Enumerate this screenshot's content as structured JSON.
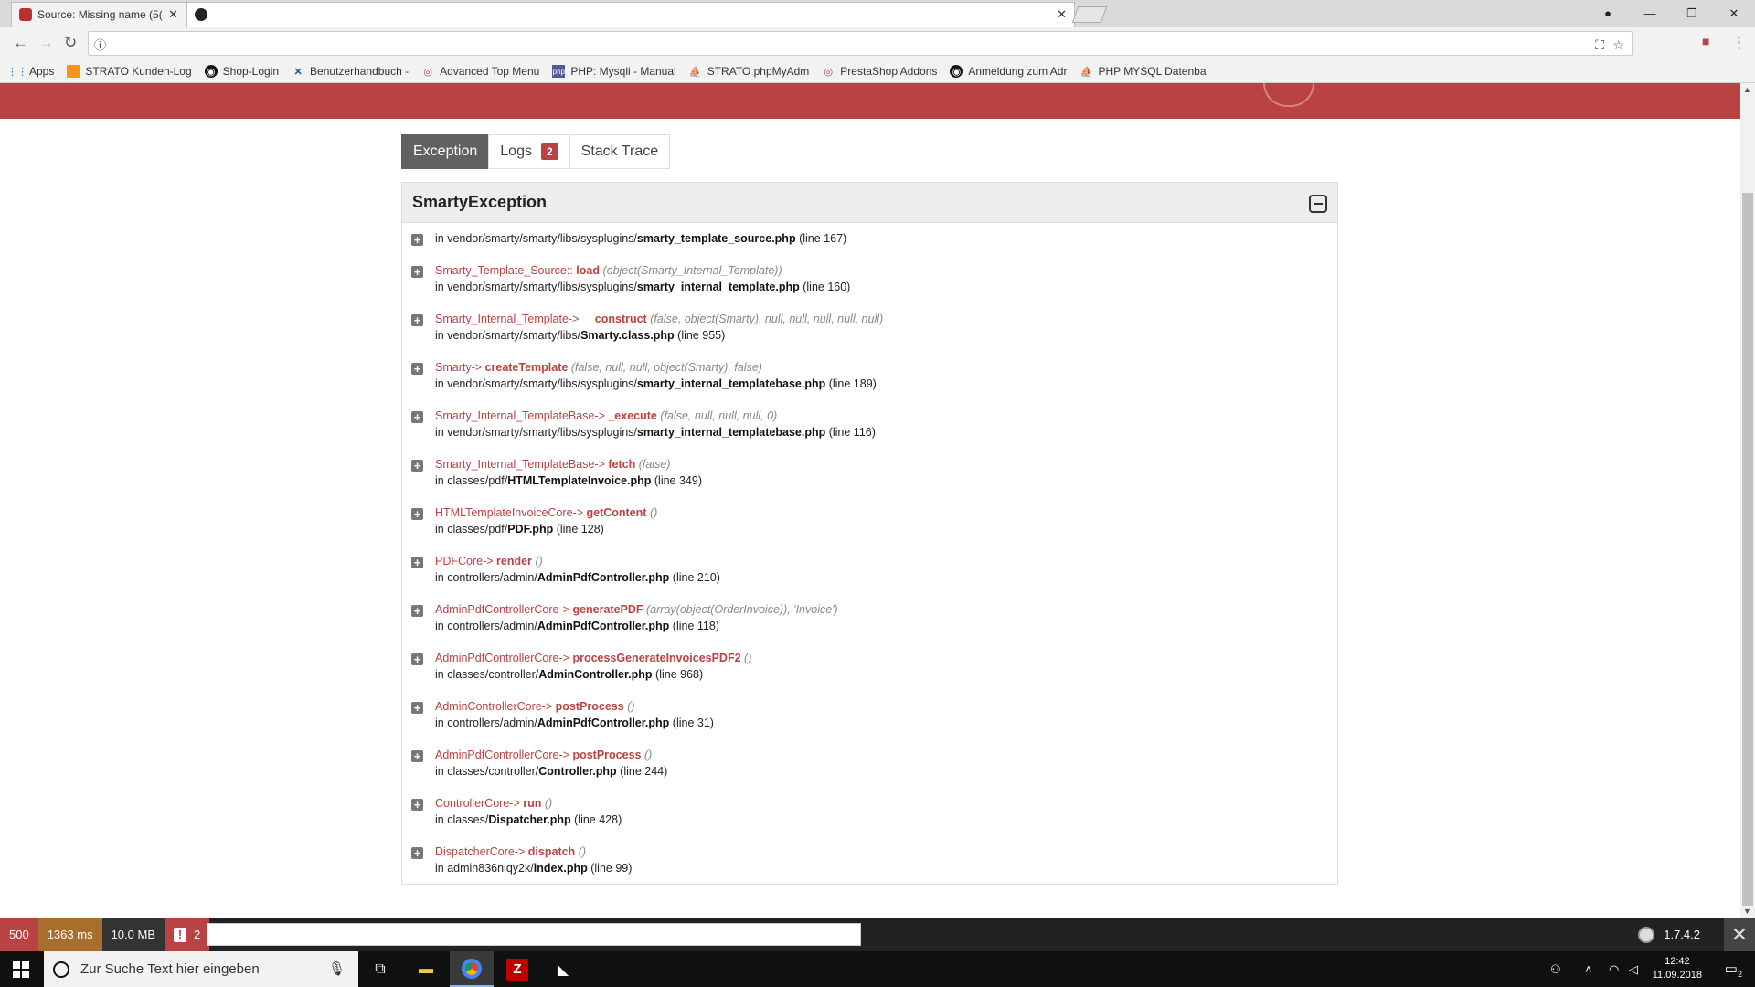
{
  "browser": {
    "active_tab_title": "Source: Missing name (5(",
    "address_icon": "info-icon",
    "bookmarks": [
      {
        "label": "Apps",
        "icon": "apps-grid-icon"
      },
      {
        "label": "STRATO Kunden-Log",
        "icon": "strato-icon"
      },
      {
        "label": "Shop-Login",
        "icon": "prestashop-icon"
      },
      {
        "label": "Benutzerhandbuch -",
        "icon": "confluence-icon"
      },
      {
        "label": "Advanced Top Menu",
        "icon": "addon-icon"
      },
      {
        "label": "PHP: Mysqli - Manual",
        "icon": "php-icon"
      },
      {
        "label": "STRATO phpMyAdm",
        "icon": "phpmyadmin-icon"
      },
      {
        "label": "PrestaShop Addons",
        "icon": "addon-icon"
      },
      {
        "label": "Anmeldung zum Adr",
        "icon": "prestashop-icon"
      },
      {
        "label": "PHP MYSQL Datenba",
        "icon": "phpmyadmin-icon"
      }
    ]
  },
  "tabs": [
    {
      "label": "Exception",
      "active": true
    },
    {
      "label": "Logs",
      "badge": "2"
    },
    {
      "label": "Stack Trace"
    }
  ],
  "exception": {
    "title": "SmartyException",
    "frames": [
      {
        "class": "",
        "type": "",
        "function": "",
        "args": "",
        "path": "in vendor/smarty/smarty/libs/sysplugins/",
        "file": "smarty_template_source.php",
        "line": "(line 167)"
      },
      {
        "class": "Smarty_Template_Source",
        "type": "::",
        "function": "load",
        "args": "(object(Smarty_Internal_Template))",
        "path": "in vendor/smarty/smarty/libs/sysplugins/",
        "file": "smarty_internal_template.php",
        "line": "(line 160)"
      },
      {
        "class": "Smarty_Internal_Template",
        "type": "->",
        "function": "__construct",
        "args": "(false, object(Smarty), null, null, null, null, null)",
        "path": "in vendor/smarty/smarty/libs/",
        "file": "Smarty.class.php",
        "line": "(line 955)"
      },
      {
        "class": "Smarty",
        "type": "->",
        "function": "createTemplate",
        "args": "(false, null, null, object(Smarty), false)",
        "path": "in vendor/smarty/smarty/libs/sysplugins/",
        "file": "smarty_internal_templatebase.php",
        "line": "(line 189)"
      },
      {
        "class": "Smarty_Internal_TemplateBase",
        "type": "->",
        "function": "_execute",
        "args": "(false, null, null, null, 0)",
        "path": "in vendor/smarty/smarty/libs/sysplugins/",
        "file": "smarty_internal_templatebase.php",
        "line": "(line 116)"
      },
      {
        "class": "Smarty_Internal_TemplateBase",
        "type": "->",
        "function": "fetch",
        "args": "(false)",
        "path": "in classes/pdf/",
        "file": "HTMLTemplateInvoice.php",
        "line": "(line 349)"
      },
      {
        "class": "HTMLTemplateInvoiceCore",
        "type": "->",
        "function": "getContent",
        "args": "()",
        "path": "in classes/pdf/",
        "file": "PDF.php",
        "line": "(line 128)"
      },
      {
        "class": "PDFCore",
        "type": "->",
        "function": "render",
        "args": "()",
        "path": "in controllers/admin/",
        "file": "AdminPdfController.php",
        "line": "(line 210)"
      },
      {
        "class": "AdminPdfControllerCore",
        "type": "->",
        "function": "generatePDF",
        "args": "(array(object(OrderInvoice)), 'Invoice')",
        "path": "in controllers/admin/",
        "file": "AdminPdfController.php",
        "line": "(line 118)"
      },
      {
        "class": "AdminPdfControllerCore",
        "type": "->",
        "function": "processGenerateInvoicesPDF2",
        "args": "()",
        "path": "in classes/controller/",
        "file": "AdminController.php",
        "line": "(line 968)"
      },
      {
        "class": "AdminControllerCore",
        "type": "->",
        "function": "postProcess",
        "args": "()",
        "path": "in controllers/admin/",
        "file": "AdminPdfController.php",
        "line": "(line 31)"
      },
      {
        "class": "AdminPdfControllerCore",
        "type": "->",
        "function": "postProcess",
        "args": "()",
        "path": "in classes/controller/",
        "file": "Controller.php",
        "line": "(line 244)"
      },
      {
        "class": "ControllerCore",
        "type": "->",
        "function": "run",
        "args": "()",
        "path": "in classes/",
        "file": "Dispatcher.php",
        "line": "(line 428)"
      },
      {
        "class": "DispatcherCore",
        "type": "->",
        "function": "dispatch",
        "args": "()",
        "path": "in admin836niqy2k/",
        "file": "index.php",
        "line": "(line 99)"
      }
    ]
  },
  "debugbar": {
    "status": "500",
    "time": "1363 ms",
    "memory": "10.0 MB",
    "errors": "2",
    "version": "1.7.4.2"
  },
  "taskbar": {
    "search_placeholder": "Zur Suche Text hier eingeben",
    "time": "12:42",
    "date": "11.09.2018",
    "notification_count": "2"
  },
  "colors": {
    "accent": "#b84342",
    "tab_active": "#616161"
  }
}
